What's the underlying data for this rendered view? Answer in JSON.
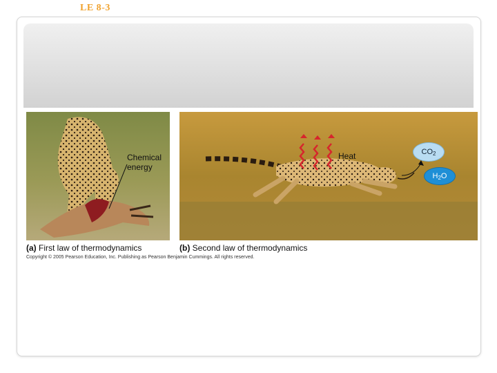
{
  "slide": {
    "title": "LE 8-3"
  },
  "figure": {
    "panel_a": {
      "letter": "(a)",
      "caption": "First law of thermodynamics",
      "label_line1": "Chemical",
      "label_line2": "energy"
    },
    "panel_b": {
      "letter": "(b)",
      "caption": "Second law of thermodynamics",
      "heat_label": "Heat",
      "co2_main": "CO",
      "co2_sub": "2",
      "h2o_h": "H",
      "h2o_sub": "2",
      "h2o_o": "O"
    },
    "credit": "Copyright © 2005 Pearson Education, Inc. Publishing as Pearson Benjamin Cummings. All rights reserved."
  },
  "colors": {
    "title": "#f0a22e",
    "heat_arrows": "#d6262c",
    "co2_bubble": "#b9dcf2",
    "h2o_bubble": "#1f8fd6"
  }
}
